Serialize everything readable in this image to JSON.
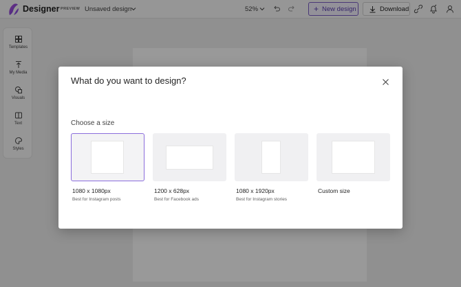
{
  "app": {
    "brand": "Designer",
    "badge": "PREVIEW",
    "document_name": "Unsaved design"
  },
  "toolbar": {
    "zoom": "52%",
    "new_design_label": "New design",
    "download_label": "Download"
  },
  "rail": {
    "items": [
      {
        "label": "Templates",
        "icon": "templates-icon"
      },
      {
        "label": "My Media",
        "icon": "upload-icon"
      },
      {
        "label": "Visuals",
        "icon": "shapes-icon"
      },
      {
        "label": "Text",
        "icon": "text-icon"
      },
      {
        "label": "Styles",
        "icon": "palette-icon"
      }
    ]
  },
  "dialog": {
    "title": "What do you want to design?",
    "section_label": "Choose a size",
    "options": [
      {
        "title": "1080 x 1080px",
        "subtitle": "Best for Instagram posts",
        "selected": true
      },
      {
        "title": "1200 x 628px",
        "subtitle": "Best for Facebook ads",
        "selected": false
      },
      {
        "title": "1080 x 1920px",
        "subtitle": "Best for Instagram stories",
        "selected": false
      },
      {
        "title": "Custom size",
        "subtitle": "",
        "selected": false
      }
    ]
  },
  "colors": {
    "accent": "#7a5dc7",
    "selected_border": "#8a6cdc",
    "overlay": "rgba(0,0,0,0.40)"
  }
}
